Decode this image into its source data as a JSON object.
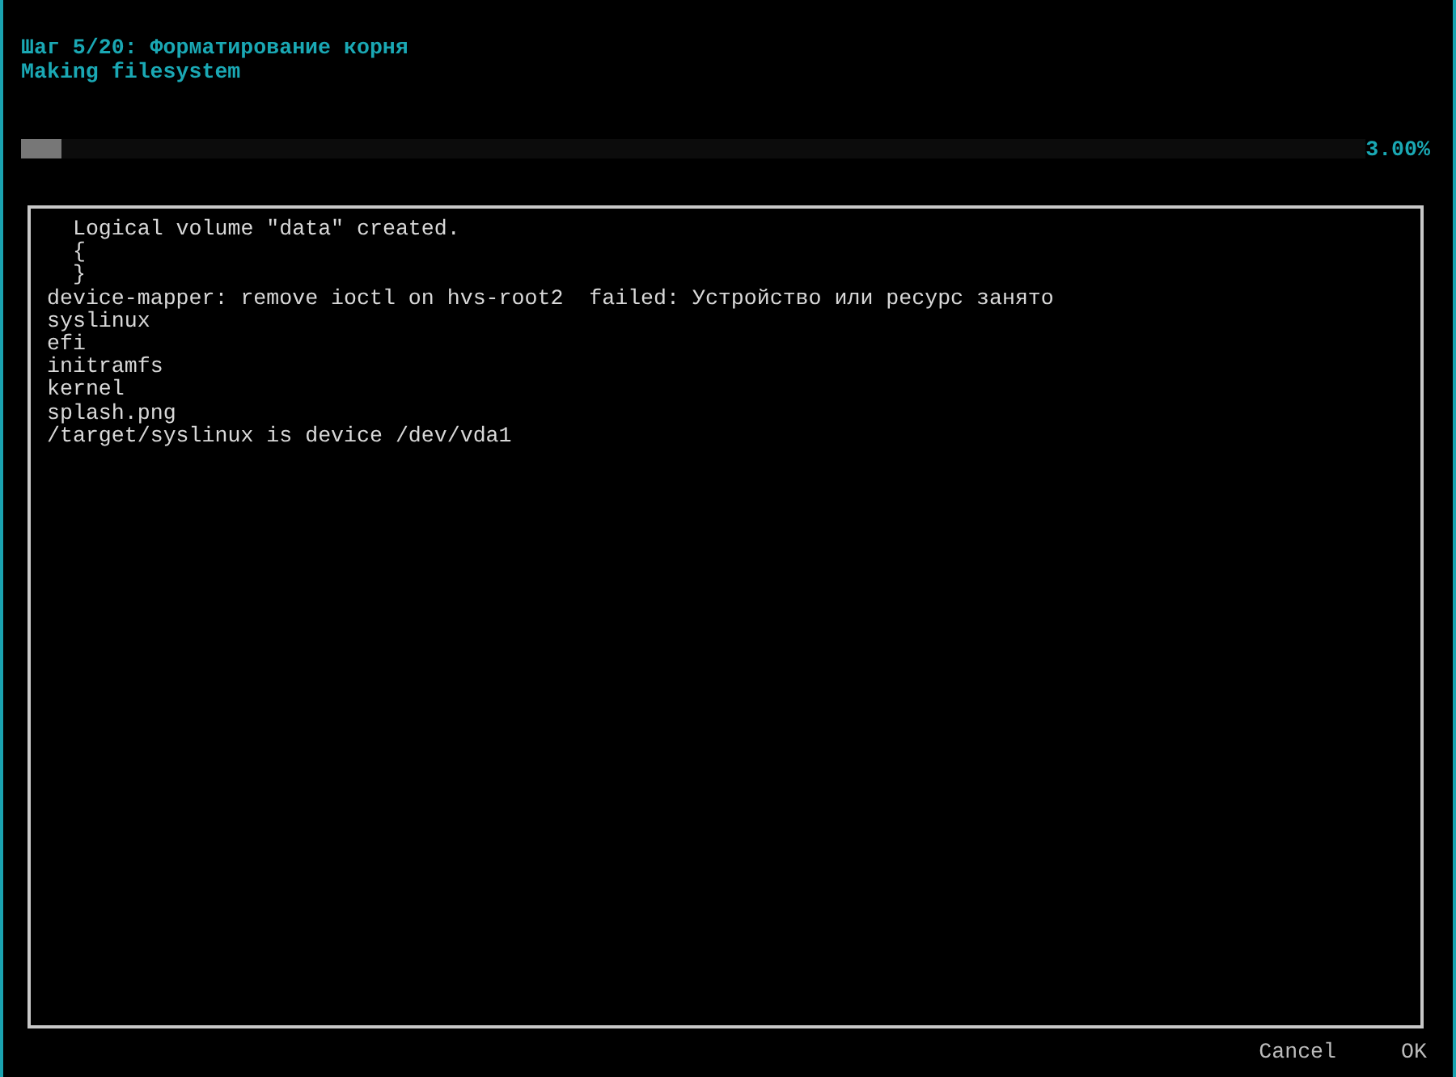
{
  "header": {
    "title": "Шаг 5/20: Форматирование корня",
    "subtitle": "Making filesystem"
  },
  "progress": {
    "level": 0.03,
    "reading": "3.00%"
  },
  "log": {
    "lines": [
      "  Logical volume \"data\" created.",
      "  {",
      "  }",
      "device-mapper: remove ioctl on hvs-root2  failed: Устройство или ресурс занято",
      "syslinux",
      "efi",
      "initramfs",
      "kernel",
      "splash.png",
      "/target/syslinux is device /dev/vda1"
    ]
  },
  "buttons": [
    {
      "label": "Cancel"
    },
    {
      "label": "OK"
    }
  ]
}
